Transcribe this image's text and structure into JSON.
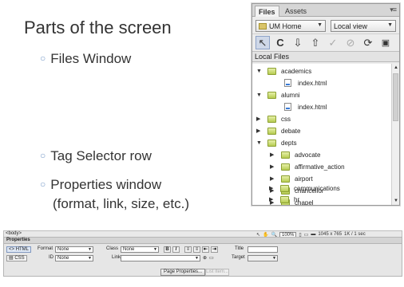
{
  "slide": {
    "title": "Parts of the screen",
    "bullets": [
      "Files Window",
      "Tag Selector row",
      "Properties window",
      "(format, link, size, etc.)"
    ]
  },
  "files_panel": {
    "tabs": [
      "Files",
      "Assets"
    ],
    "site_dropdown": "UM Home",
    "view_dropdown": "Local view",
    "header": "Local Files",
    "tree": [
      {
        "label": "academics",
        "type": "folder",
        "expanded": true
      },
      {
        "label": "index.html",
        "type": "file"
      },
      {
        "label": "alumni",
        "type": "folder",
        "expanded": true
      },
      {
        "label": "index.html",
        "type": "file"
      },
      {
        "label": "css",
        "type": "folder",
        "expanded": false
      },
      {
        "label": "debate",
        "type": "folder",
        "expanded": false
      },
      {
        "label": "depts",
        "type": "folder",
        "expanded": true
      },
      {
        "label": "advocate",
        "type": "folder",
        "expanded": false
      },
      {
        "label": "affirmative_action",
        "type": "folder",
        "expanded": false
      },
      {
        "label": "airport",
        "type": "folder",
        "expanded": false
      },
      {
        "label": "chancellor",
        "type": "folder",
        "expanded": false
      },
      {
        "label": "chapel",
        "type": "folder",
        "expanded": false
      },
      {
        "label": "communications",
        "type": "folder",
        "expanded": false
      },
      {
        "label": "hr",
        "type": "folder",
        "expanded": false
      }
    ]
  },
  "tag_selector": {
    "tag": "<body>",
    "zoom": "100%",
    "dimensions": "1045 x 765",
    "size": "1K / 1 sec"
  },
  "properties": {
    "title": "Properties",
    "html_tab": "HTML",
    "css_tab": "CSS",
    "format_label": "Format",
    "format_value": "None",
    "class_label": "Class",
    "class_value": "None",
    "id_label": "ID",
    "id_value": "None",
    "link_label": "Link",
    "title_label": "Title",
    "target_label": "Target",
    "bold_label": "B",
    "italic_label": "I",
    "page_properties_button": "Page Properties...",
    "list_item_button": "List Item..."
  },
  "colors": {
    "bullet": "#7a9cc9",
    "folder": "#b7cc52"
  }
}
